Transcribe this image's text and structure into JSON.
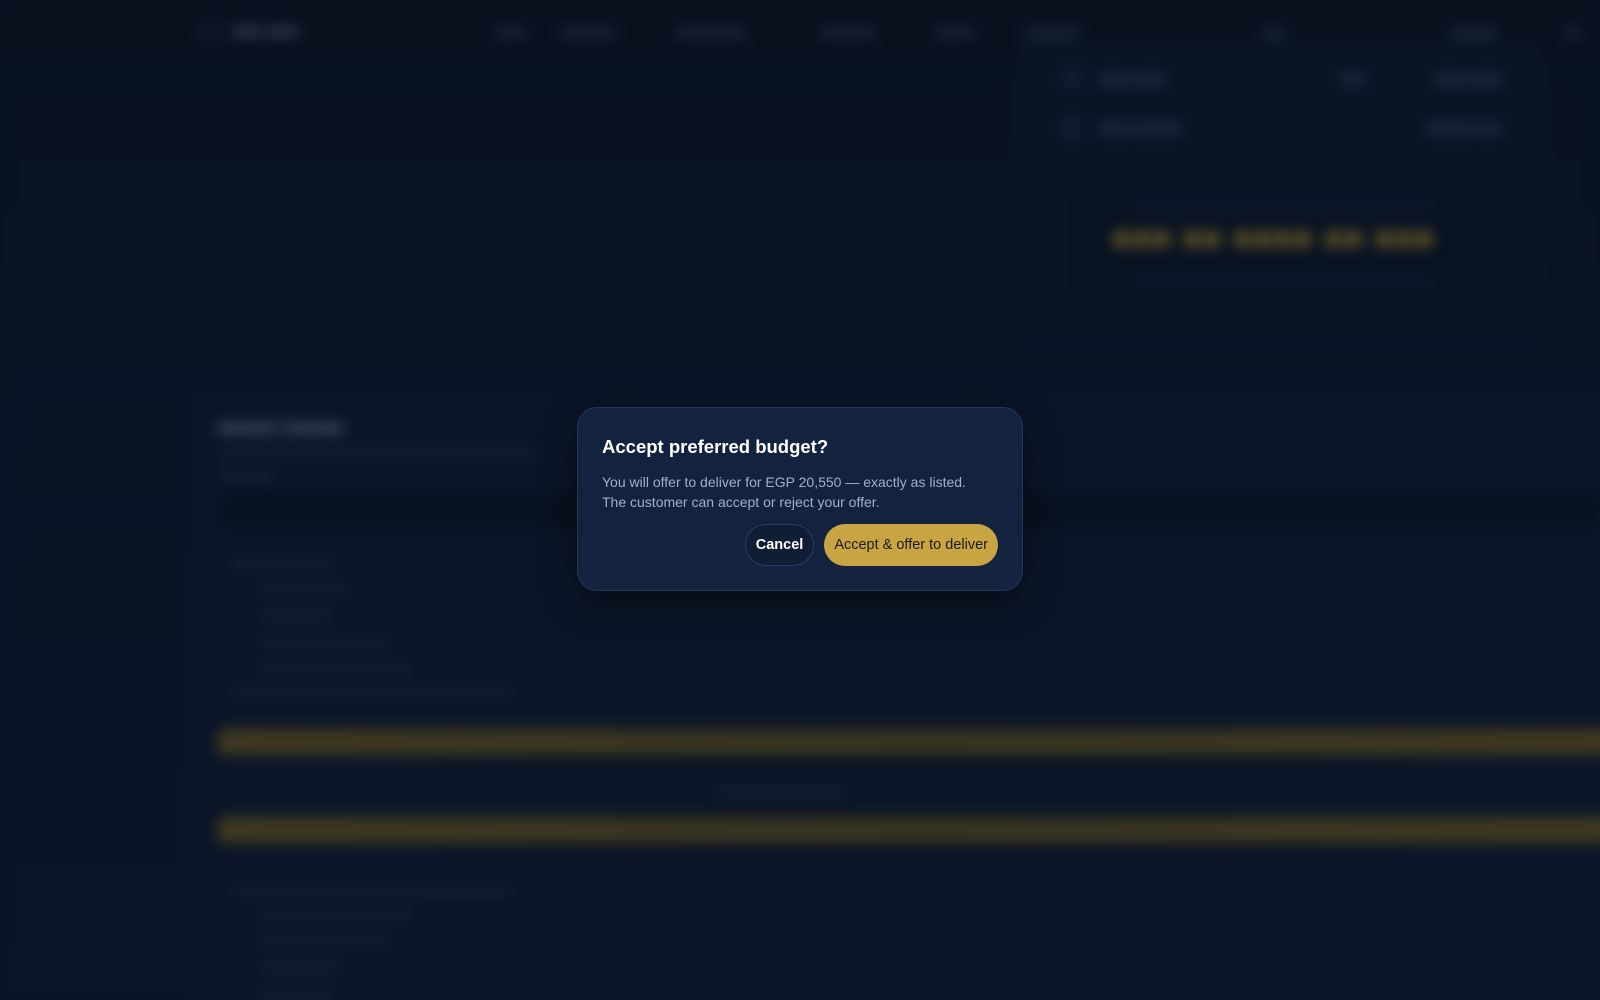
{
  "modal": {
    "title": "Accept preferred budget?",
    "body_line_1": "You will offer to deliver for EGP 20,550 — exactly as listed.",
    "body_line_2": "The customer can accept or reject your offer.",
    "cancel_label": "Cancel",
    "accept_label": "Accept & offer to deliver"
  },
  "colors": {
    "background": "#0b1628",
    "modal_background": "#13233f",
    "accent_gold": "#c9a443",
    "text_primary": "#ffffff",
    "text_secondary": "#9fb0c9"
  }
}
